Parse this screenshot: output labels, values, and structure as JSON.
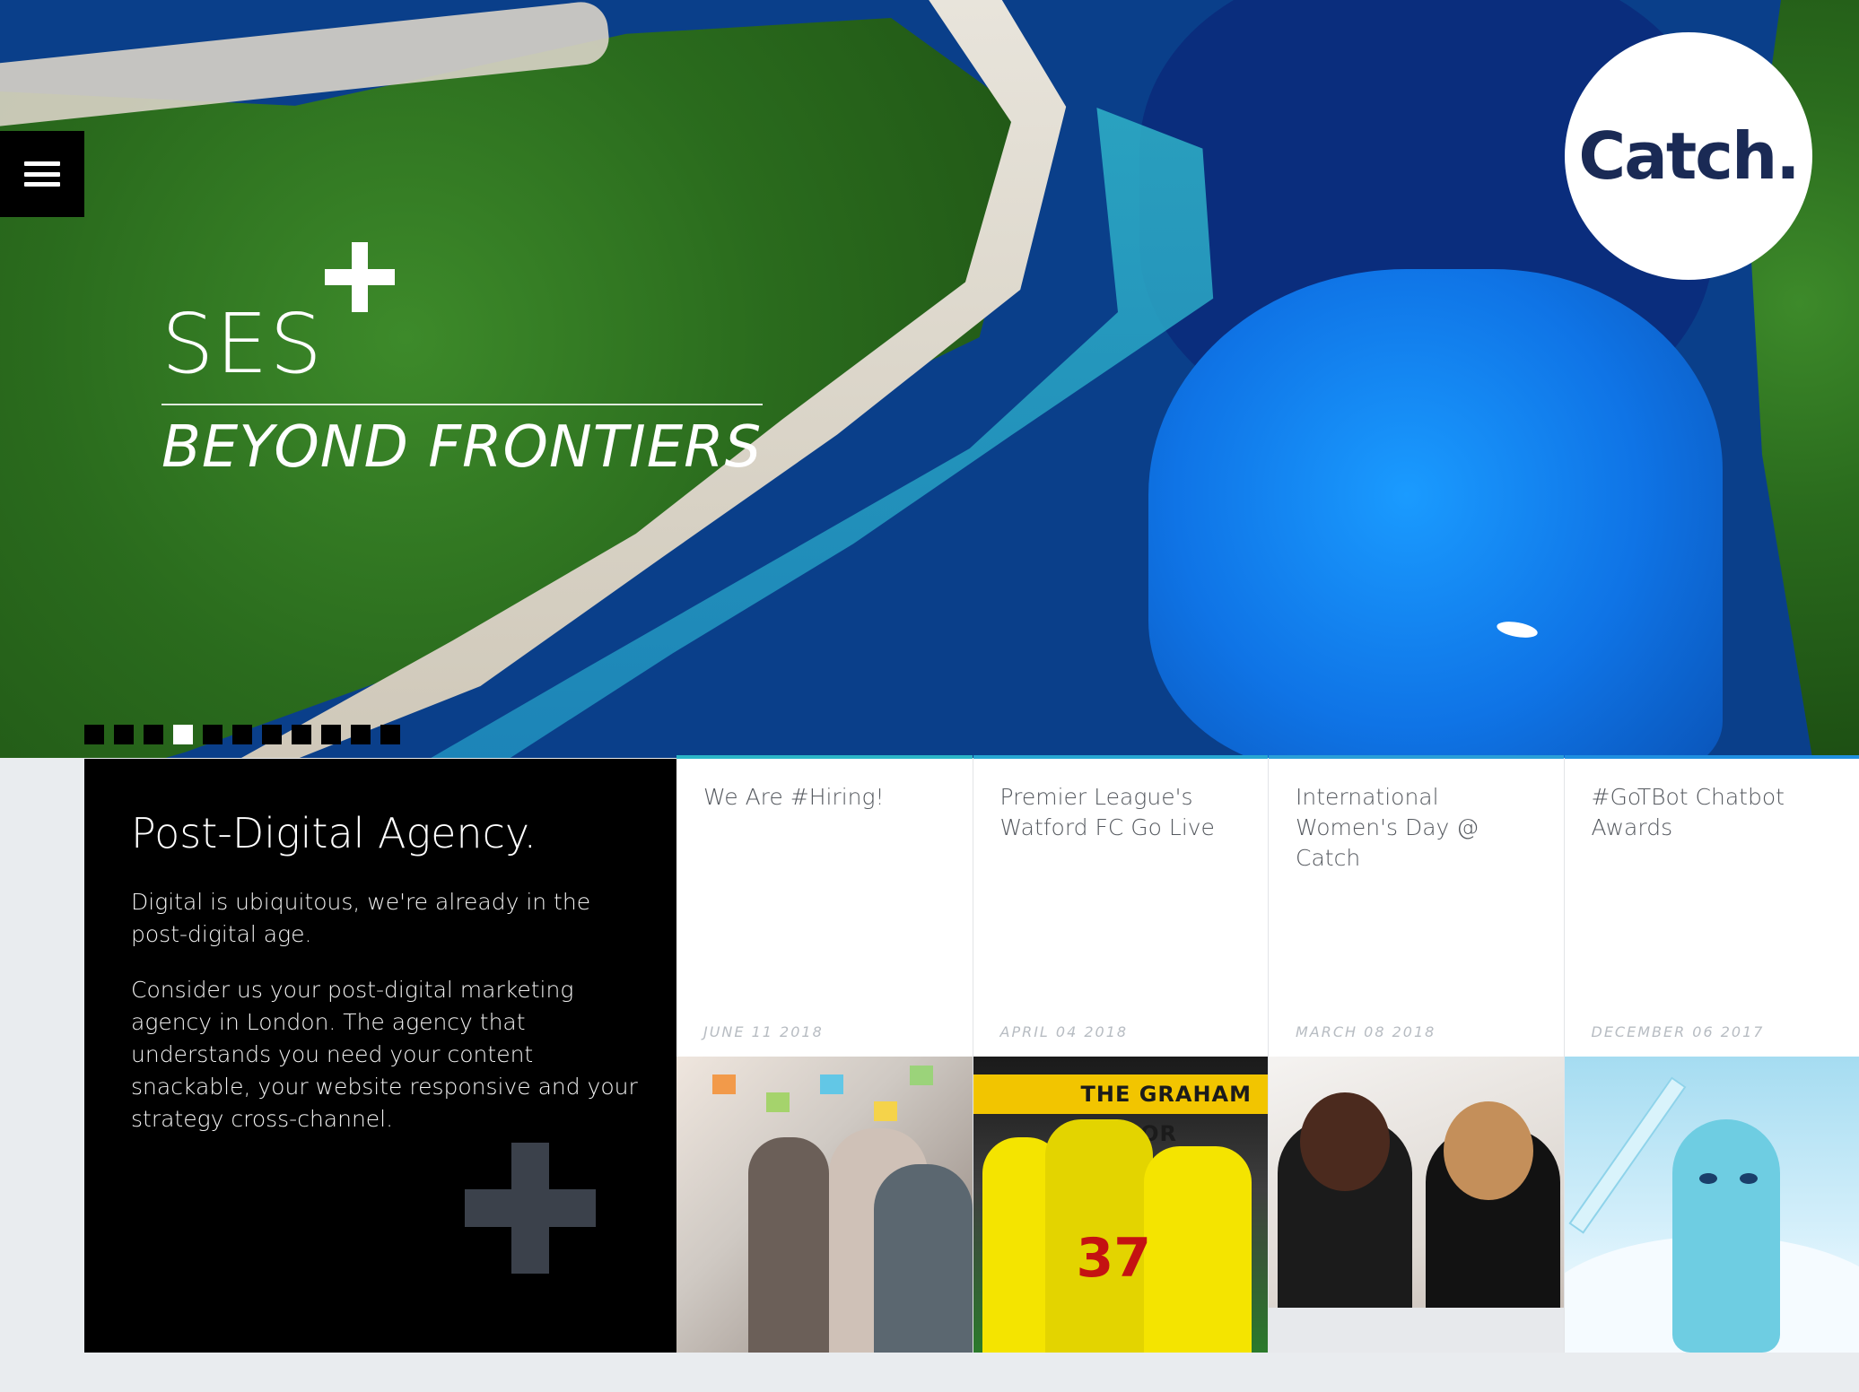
{
  "brand": {
    "logo_text": "Catch.",
    "logo_color": "#1a2a55"
  },
  "menu": {
    "icon": "hamburger-icon"
  },
  "hero": {
    "title": "SES",
    "subtitle": "BEYOND FRONTIERS",
    "slider": {
      "count": 11,
      "active_index": 3
    }
  },
  "agency": {
    "heading": "Post-Digital Agency.",
    "paragraph_1": "Digital is ubiquitous, we're already in the post-digital age.",
    "paragraph_2": "Consider us your post-digital marketing agency in London. The agency that understands you need your content snackable, your website responsive and your strategy cross-channel."
  },
  "news": [
    {
      "title": "We Are #Hiring!",
      "date": "JUNE 11 2018",
      "accent": "#2bb6c7"
    },
    {
      "title": "Premier League's Watford FC Go Live",
      "date": "APRIL 04 2018",
      "accent": "#27a7d2"
    },
    {
      "title": "International Women's Day @ Catch",
      "date": "MARCH 08 2018",
      "accent": "#2a9fd8"
    },
    {
      "title": "#GoTBot Chatbot Awards",
      "date": "DECEMBER 06 2017",
      "accent": "#1f8fe0"
    }
  ],
  "football_banner": "THE GRAHAM TAYLOR",
  "football_number": "37"
}
